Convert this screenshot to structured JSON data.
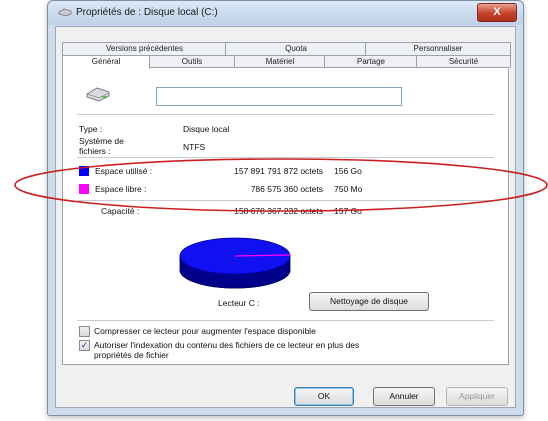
{
  "window": {
    "title": "Propriétés de : Disque local (C:)",
    "close_label": "X"
  },
  "tabs_top": [
    {
      "label": "Versions précédentes"
    },
    {
      "label": "Quota"
    },
    {
      "label": "Personnaliser"
    }
  ],
  "tabs_bottom": [
    {
      "label": "Général"
    },
    {
      "label": "Outils"
    },
    {
      "label": "Matériel"
    },
    {
      "label": "Partage"
    },
    {
      "label": "Sécurité"
    }
  ],
  "general": {
    "name_value": "",
    "type_label": "Type :",
    "type_value": "Disque local",
    "fs_label": "Système de fichiers :",
    "fs_value": "NTFS",
    "used": {
      "label": "Espace utilisé :",
      "bytes": "157 891 791 872 octets",
      "size": "156 Go",
      "color": "#0000ff"
    },
    "free": {
      "label": "Espace libre :",
      "bytes": "786 575 360 octets",
      "size": "750 Mo",
      "color": "#ff00ff"
    },
    "capacity": {
      "label": "Capacité :",
      "bytes": "158 678 367 232 octets",
      "size": "157 Go"
    },
    "drive_label": "Lecteur C :",
    "cleanup_button": "Nettoyage de disque",
    "compress_label": "Compresser ce lecteur pour augmenter l'espace disponible",
    "compress_checked": false,
    "index_label_line1": "Autoriser l'indexation du contenu des fichiers de ce lecteur en plus des",
    "index_label_line2": "propriétés de fichier",
    "index_checked": true,
    "check_mark": "✓"
  },
  "buttons": {
    "ok": "OK",
    "cancel": "Annuler",
    "apply": "Appliquer"
  },
  "annotation": {
    "color": "#cc1f1f"
  },
  "pie_usage": {
    "used_fraction": 0.995,
    "free_fraction": 0.005
  }
}
